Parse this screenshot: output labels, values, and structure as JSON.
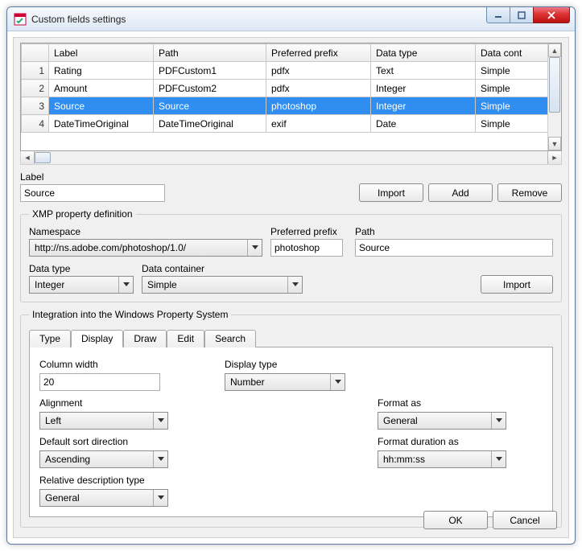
{
  "window": {
    "title": "Custom fields settings"
  },
  "grid": {
    "headers": [
      "Label",
      "Path",
      "Preferred prefix",
      "Data type",
      "Data cont"
    ],
    "rows": [
      {
        "n": "1",
        "label": "Rating",
        "path": "PDFCustom1",
        "prefix": "pdfx",
        "dtype": "Text",
        "cont": "Simple"
      },
      {
        "n": "2",
        "label": "Amount",
        "path": "PDFCustom2",
        "prefix": "pdfx",
        "dtype": "Integer",
        "cont": "Simple"
      },
      {
        "n": "3",
        "label": "Source",
        "path": "Source",
        "prefix": "photoshop",
        "dtype": "Integer",
        "cont": "Simple"
      },
      {
        "n": "4",
        "label": "DateTimeOriginal",
        "path": "DateTimeOriginal",
        "prefix": "exif",
        "dtype": "Date",
        "cont": "Simple"
      }
    ],
    "selected_index": 2
  },
  "editor": {
    "label_caption": "Label",
    "label_value": "Source",
    "buttons": {
      "import": "Import",
      "add": "Add",
      "remove": "Remove"
    }
  },
  "xmp": {
    "legend": "XMP property definition",
    "namespace_label": "Namespace",
    "namespace_value": "http://ns.adobe.com/photoshop/1.0/",
    "prefix_label": "Preferred prefix",
    "prefix_value": "photoshop",
    "path_label": "Path",
    "path_value": "Source",
    "dtype_label": "Data type",
    "dtype_value": "Integer",
    "container_label": "Data container",
    "container_value": "Simple",
    "import_btn": "Import"
  },
  "wps": {
    "legend": "Integration into the Windows Property System",
    "tabs": [
      "Type",
      "Display",
      "Draw",
      "Edit",
      "Search"
    ],
    "active_tab": 1,
    "display": {
      "column_width_label": "Column width",
      "column_width_value": "20",
      "alignment_label": "Alignment",
      "alignment_value": "Left",
      "sort_label": "Default sort direction",
      "sort_value": "Ascending",
      "reldesc_label": "Relative description type",
      "reldesc_value": "General",
      "display_type_label": "Display type",
      "display_type_value": "Number",
      "format_as_label": "Format as",
      "format_as_value": "General",
      "format_dur_label": "Format duration as",
      "format_dur_value": "hh:mm:ss"
    }
  },
  "dialog_buttons": {
    "ok": "OK",
    "cancel": "Cancel"
  }
}
